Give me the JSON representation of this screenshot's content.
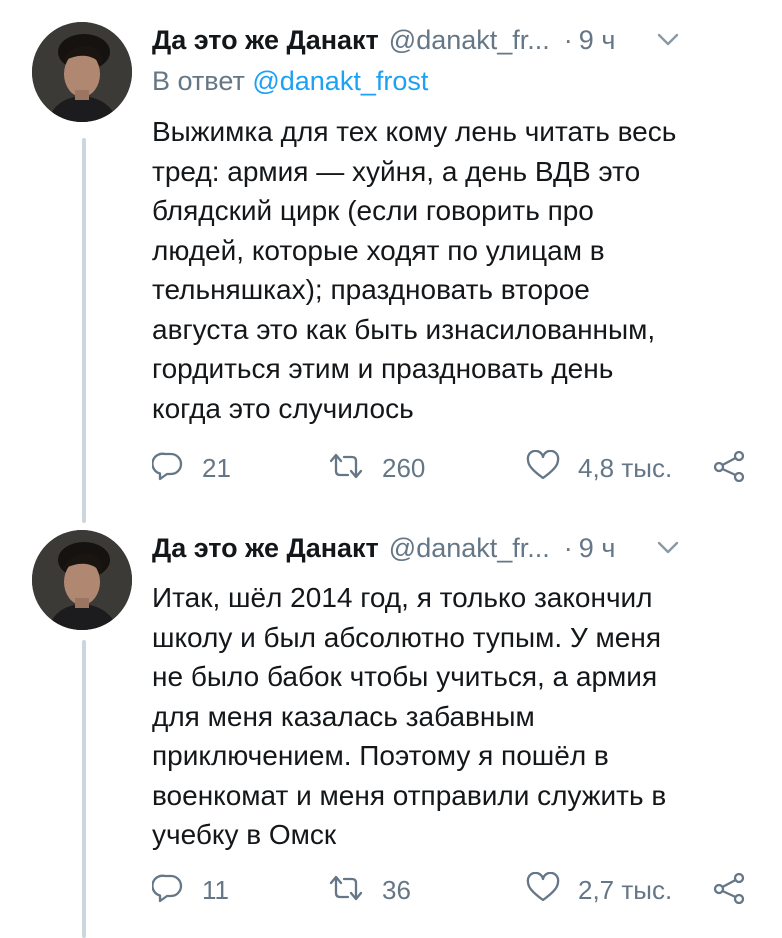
{
  "tweets": [
    {
      "author_name": "Да это же Данакт",
      "handle": "@danakt_fr...",
      "dot": "·",
      "time": "9 ч",
      "reply_prefix": "В ответ",
      "reply_mention": "@danakt_frost",
      "lines": [
        "Выжимка для тех кому лень читать весь",
        "тред: армия — хуйня, а день ВДВ это",
        "блядский цирк (если говорить про",
        "людей, которые ходят по улицам в",
        "тельняшках); праздновать второе",
        "августа это как быть изнасилованным,",
        "гордиться этим и праздновать день",
        "когда это случилось"
      ],
      "replies": "21",
      "retweets": "260",
      "likes": "4,8 тыс."
    },
    {
      "author_name": "Да это же Данакт",
      "handle": "@danakt_fr...",
      "dot": "·",
      "time": "9 ч",
      "lines": [
        "Итак, шёл 2014 год, я только закончил",
        "школу и был абсолютно тупым. У меня",
        "не было бабок чтобы учиться, а армия",
        "для меня казалась забавным",
        "приключением. Поэтому я пошёл в",
        "военкомат и меня отправили служить в",
        "учебку в Омск"
      ],
      "replies": "11",
      "retweets": "36",
      "likes": "2,7 тыс."
    }
  ],
  "icons": {
    "reply": "reply-icon",
    "retweet": "retweet-icon",
    "like": "heart-icon",
    "share": "share-icon",
    "caret": "chevron-down-icon"
  },
  "colors": {
    "text": "#14171a",
    "secondary": "#657786",
    "link": "#1da1f2",
    "thread_line": "#ccd6dd"
  }
}
